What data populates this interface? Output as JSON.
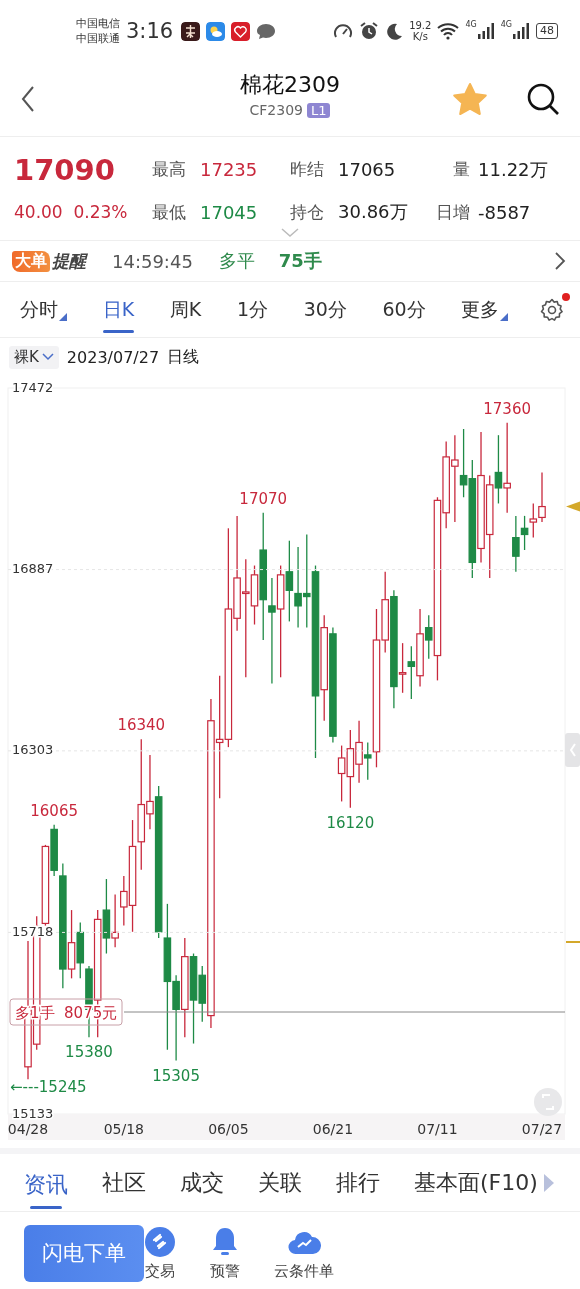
{
  "status_bar": {
    "carriers": [
      "中国电信",
      "中国联通"
    ],
    "time": "3:16",
    "speed": "19.2",
    "speed_unit": "K/s",
    "networks": [
      "4G",
      "4G"
    ],
    "battery": "48"
  },
  "header": {
    "title": "棉花2309",
    "code": "CF2309",
    "badge": "L1",
    "favorite": true
  },
  "quote": {
    "price": "17090",
    "change": "40.00",
    "change_pct": "0.23%",
    "color": "#c8283c",
    "stats": [
      {
        "label": "最高",
        "value": "17235",
        "color": "#c8283c"
      },
      {
        "label": "昨结",
        "value": "17065",
        "color": "#222222"
      },
      {
        "label": "量",
        "value": "11.22万",
        "color": "#222222"
      },
      {
        "label": "最低",
        "value": "17045",
        "color": "#1e8a46"
      },
      {
        "label": "持仓",
        "value": "30.86万",
        "color": "#222222"
      },
      {
        "label": "日增",
        "value": "-8587",
        "color": "#222222"
      }
    ]
  },
  "alert": {
    "badge": "大单",
    "title": "提醒",
    "time": "14:59:45",
    "action": "多平",
    "volume": "75手"
  },
  "period_tabs": [
    {
      "label": "分时",
      "selected": false,
      "has_menu": true
    },
    {
      "label": "日K",
      "selected": true,
      "has_menu": false
    },
    {
      "label": "周K",
      "selected": false,
      "has_menu": false
    },
    {
      "label": "1分",
      "selected": false,
      "has_menu": false
    },
    {
      "label": "30分",
      "selected": false,
      "has_menu": false
    },
    {
      "label": "60分",
      "selected": false,
      "has_menu": false
    },
    {
      "label": "更多",
      "selected": false,
      "has_menu": true
    }
  ],
  "settings": {
    "notification": true
  },
  "chart_header": {
    "mode": "裸K",
    "date": "2023/07/27",
    "period": "日线"
  },
  "chart": {
    "chart_data": {
      "type": "candlestick",
      "grid": true,
      "ylim": [
        15133,
        17472
      ],
      "yticks": [
        17472,
        16887,
        16303,
        15718,
        15133
      ],
      "categories": [
        "04/28",
        null,
        null,
        null,
        null,
        null,
        null,
        null,
        null,
        null,
        null,
        "05/18",
        null,
        null,
        null,
        null,
        null,
        null,
        null,
        null,
        null,
        null,
        null,
        "06/05",
        null,
        null,
        null,
        null,
        null,
        null,
        null,
        null,
        null,
        null,
        null,
        "06/21",
        null,
        null,
        null,
        null,
        null,
        null,
        null,
        null,
        null,
        null,
        null,
        "07/11",
        null,
        null,
        null,
        null,
        null,
        null,
        null,
        null,
        null,
        null,
        null,
        "07/27"
      ],
      "ohlc": [
        [
          15285,
          15690,
          15245,
          15478
        ],
        [
          15358,
          15770,
          15340,
          15737
        ],
        [
          15747,
          16000,
          15740,
          15995
        ],
        [
          16050,
          16065,
          15900,
          15918
        ],
        [
          15900,
          15940,
          15538,
          15600
        ],
        [
          15600,
          15790,
          15570,
          15685
        ],
        [
          15718,
          15750,
          15570,
          15620
        ],
        [
          15600,
          15610,
          15380,
          15470
        ],
        [
          15500,
          15790,
          15380,
          15760
        ],
        [
          15790,
          15890,
          15650,
          15700
        ],
        [
          15700,
          15840,
          15670,
          15718
        ],
        [
          15800,
          15900,
          15740,
          15850
        ],
        [
          15805,
          16080,
          15720,
          15995
        ],
        [
          16010,
          16340,
          15920,
          16130
        ],
        [
          16100,
          16290,
          16050,
          16140
        ],
        [
          16155,
          16190,
          15700,
          15720
        ],
        [
          15700,
          15810,
          15340,
          15560
        ],
        [
          15560,
          15580,
          15305,
          15470
        ],
        [
          15470,
          15700,
          15380,
          15640
        ],
        [
          15640,
          15650,
          15360,
          15500
        ],
        [
          15580,
          15610,
          15430,
          15490
        ],
        [
          15450,
          16470,
          15410,
          16400
        ],
        [
          16330,
          16545,
          16150,
          16340
        ],
        [
          16340,
          17020,
          16315,
          16760
        ],
        [
          16730,
          17060,
          16690,
          16860
        ],
        [
          16810,
          16920,
          16540,
          16815
        ],
        [
          16770,
          16900,
          16710,
          16870
        ],
        [
          16950,
          17070,
          16660,
          16790
        ],
        [
          16770,
          16860,
          16520,
          16750
        ],
        [
          16760,
          16900,
          16540,
          16870
        ],
        [
          16880,
          16980,
          16720,
          16820
        ],
        [
          16810,
          16960,
          16700,
          16770
        ],
        [
          16810,
          17000,
          16700,
          16800
        ],
        [
          16880,
          16900,
          16280,
          16480
        ],
        [
          16500,
          16740,
          16400,
          16700
        ],
        [
          16680,
          16700,
          16330,
          16350
        ],
        [
          16230,
          16320,
          16140,
          16280
        ],
        [
          16220,
          16370,
          16120,
          16310
        ],
        [
          16260,
          16400,
          16200,
          16330
        ],
        [
          16290,
          16330,
          16210,
          16280
        ],
        [
          16300,
          16760,
          16250,
          16660
        ],
        [
          16660,
          16880,
          16620,
          16790
        ],
        [
          16800,
          16820,
          16440,
          16510
        ],
        [
          16550,
          16650,
          16490,
          16555
        ],
        [
          16590,
          16640,
          16470,
          16575
        ],
        [
          16545,
          16760,
          16510,
          16680
        ],
        [
          16700,
          16740,
          16600,
          16660
        ],
        [
          16610,
          17120,
          16530,
          17110
        ],
        [
          17070,
          17300,
          17020,
          17250
        ],
        [
          17220,
          17320,
          17040,
          17240
        ],
        [
          17190,
          17340,
          17120,
          17160
        ],
        [
          17180,
          17240,
          16860,
          16910
        ],
        [
          16955,
          17330,
          16910,
          17190
        ],
        [
          17000,
          17190,
          16860,
          17160
        ],
        [
          17200,
          17320,
          17100,
          17150
        ],
        [
          17150,
          17360,
          17070,
          17165
        ],
        [
          16990,
          17060,
          16880,
          16930
        ],
        [
          17020,
          17060,
          16950,
          17000
        ],
        [
          17040,
          17100,
          16990,
          17050
        ],
        [
          17055,
          17200,
          17040,
          17090
        ]
      ],
      "annotations": [
        {
          "y": 17360,
          "text": "17360"
        },
        {
          "y": 17070,
          "text": "17070"
        },
        {
          "y": 16340,
          "text": "16340"
        },
        {
          "y": 16065,
          "text": "16065"
        },
        {
          "y": 16120,
          "text": "16120"
        },
        {
          "y": 15380,
          "text": "15380"
        },
        {
          "y": 15305,
          "text": "15305"
        },
        "←---15245"
      ]
    },
    "position_tag": "多1手  8075元"
  },
  "bottom_tabs": [
    {
      "label": "资讯",
      "selected": true
    },
    {
      "label": "社区",
      "selected": false
    },
    {
      "label": "成交",
      "selected": false
    },
    {
      "label": "关联",
      "selected": false
    },
    {
      "label": "排行",
      "selected": false
    },
    {
      "label": "基本面(F10)",
      "selected": false
    }
  ],
  "actions": {
    "primary": "闪电下单",
    "items": [
      {
        "label": "交易",
        "kind": "trade"
      },
      {
        "label": "预警",
        "kind": "alert"
      },
      {
        "label": "云条件单",
        "kind": "cloud"
      }
    ]
  }
}
